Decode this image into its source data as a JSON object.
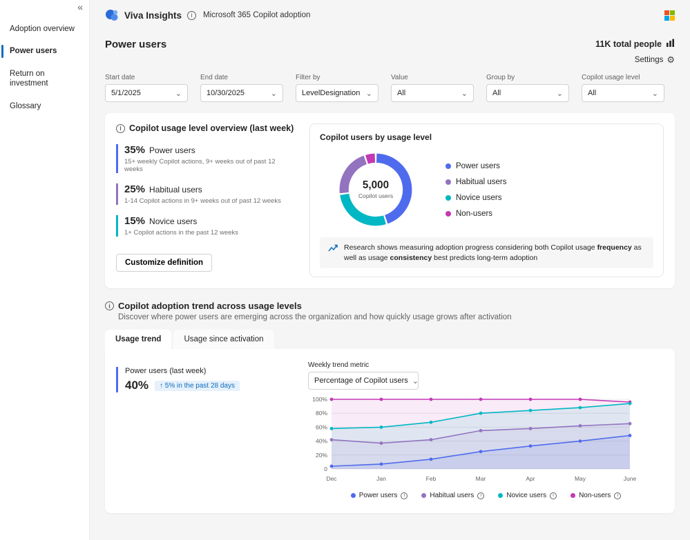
{
  "sidebar": {
    "collapse_icon": "«",
    "items": [
      {
        "label": "Adoption overview"
      },
      {
        "label": "Power users"
      },
      {
        "label": "Return on investment"
      },
      {
        "label": "Glossary"
      }
    ]
  },
  "header": {
    "app_name": "Viva Insights",
    "context": "Microsoft 365 Copilot adoption"
  },
  "page": {
    "title": "Power users",
    "total_people": "11K total people",
    "settings_label": "Settings"
  },
  "filters": [
    {
      "label": "Start date",
      "value": "5/1/2025"
    },
    {
      "label": "End date",
      "value": "10/30/2025"
    },
    {
      "label": "Filter by",
      "value": "LevelDesignation"
    },
    {
      "label": "Value",
      "value": "All"
    },
    {
      "label": "Group by",
      "value": "All"
    },
    {
      "label": "Copilot usage level",
      "value": "All"
    }
  ],
  "overview": {
    "title": "Copilot usage level overview (last week)",
    "stats": [
      {
        "percent": "35%",
        "label": "Power users",
        "desc": "15+ weekly Copilot actions, 9+ weeks out of past 12 weeks",
        "color": "#4f6bed"
      },
      {
        "percent": "25%",
        "label": "Habitual users",
        "desc": "1-14 Copilot actions in 9+ weeks out of past 12 weeks",
        "color": "#9373c0"
      },
      {
        "percent": "15%",
        "label": "Novice users",
        "desc": "1+ Copilot actions in the past 12 weeks",
        "color": "#00b7c3"
      }
    ],
    "button_label": "Customize definition"
  },
  "donut": {
    "title": "Copilot users by usage level",
    "center_value": "5,000",
    "center_label": "Copilot users",
    "legend": [
      {
        "label": "Power users",
        "color": "#4f6bed"
      },
      {
        "label": "Habitual users",
        "color": "#9373c0"
      },
      {
        "label": "Novice users",
        "color": "#00b7c3"
      },
      {
        "label": "Non-users",
        "color": "#c239b3"
      }
    ],
    "note": {
      "p1": "Research shows measuring adoption progress considering both Copilot usage",
      "b1": "frequency",
      "p2": "as well as usage",
      "b2": "consistency",
      "p3": "best predicts long-term adoption"
    }
  },
  "trend": {
    "title": "Copilot adoption trend across usage levels",
    "subtitle": "Discover where power users are emerging across the organization and how quickly usage grows after activation",
    "tabs": [
      {
        "label": "Usage trend"
      },
      {
        "label": "Usage since activation"
      }
    ],
    "metric": {
      "label": "Power users (last week)",
      "value": "40%",
      "delta": "↑ 5% in the past 28 days",
      "color": "#4f6bed"
    },
    "dropdown_label": "Weekly trend metric",
    "dropdown_value": "Percentage of Copilot users",
    "legend": [
      {
        "label": "Power users",
        "color": "#4f6bed"
      },
      {
        "label": "Habitual users",
        "color": "#9373c0"
      },
      {
        "label": "Novice users",
        "color": "#00b7c3"
      },
      {
        "label": "Non-users",
        "color": "#c239b3"
      }
    ]
  },
  "chart_data": [
    {
      "type": "donut",
      "title": "Copilot users by usage level",
      "center_value": "5,000",
      "center_label": "Copilot users",
      "slices": [
        {
          "label": "Power users",
          "value": 45,
          "color": "#4f6bed"
        },
        {
          "label": "Novice users",
          "value": 28,
          "color": "#00b7c3"
        },
        {
          "label": "Habitual users",
          "value": 22,
          "color": "#9373c0"
        },
        {
          "label": "Non-users",
          "value": 5,
          "color": "#c239b3"
        }
      ]
    },
    {
      "type": "line",
      "title": "Weekly trend metric - Percentage of Copilot users",
      "x": [
        "Dec",
        "Jan",
        "Feb",
        "Mar",
        "Apr",
        "May",
        "June"
      ],
      "ymax": 100,
      "yticks": [
        0,
        20,
        40,
        60,
        80,
        100
      ],
      "legend_position": "bottom",
      "grid": true,
      "series": [
        {
          "name": "Power users",
          "color": "#4f6bed",
          "values": [
            4,
            7,
            14,
            25,
            33,
            40,
            48
          ]
        },
        {
          "name": "Habitual users",
          "color": "#9373c0",
          "values": [
            42,
            37,
            42,
            55,
            58,
            62,
            65
          ]
        },
        {
          "name": "Novice users",
          "color": "#00b7c3",
          "values": [
            58,
            60,
            67,
            80,
            84,
            88,
            94
          ]
        },
        {
          "name": "Non-users",
          "color": "#c239b3",
          "values": [
            100,
            100,
            100,
            100,
            100,
            100,
            96
          ]
        }
      ]
    }
  ]
}
